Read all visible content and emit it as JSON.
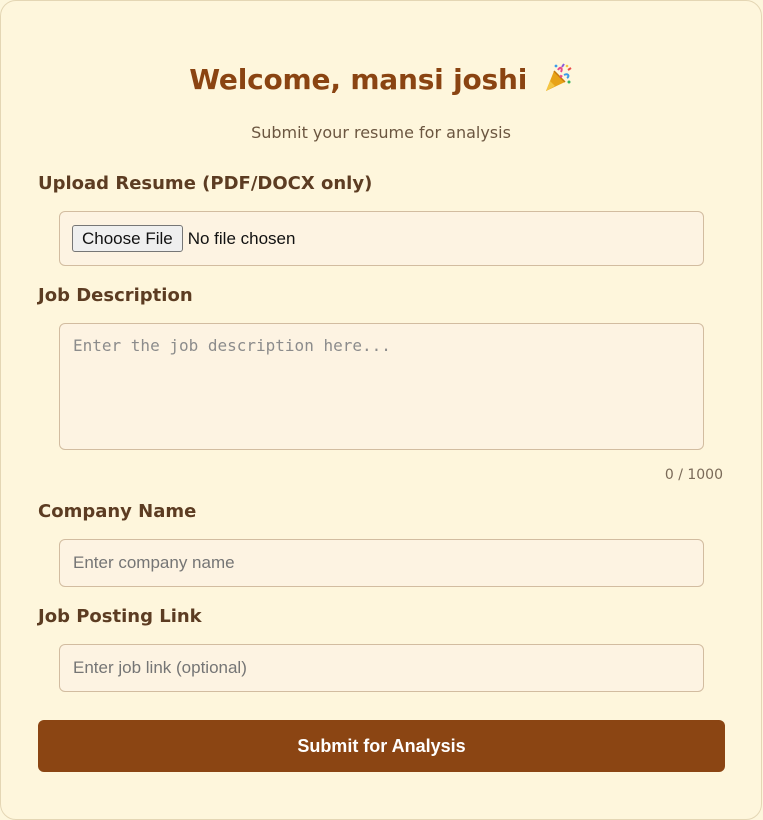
{
  "header": {
    "welcome_prefix": "Welcome, ",
    "user_name": "mansi joshi",
    "emoji_icon": "party-popper-icon",
    "subtitle": "Submit your resume for analysis"
  },
  "form": {
    "resume": {
      "label": "Upload Resume (PDF/DOCX only)",
      "button_label": "Choose File",
      "status": "No file chosen"
    },
    "job_description": {
      "label": "Job Description",
      "placeholder": "Enter the job description here...",
      "value": "",
      "counter": "0 / 1000"
    },
    "company_name": {
      "label": "Company Name",
      "placeholder": "Enter company name",
      "value": ""
    },
    "job_link": {
      "label": "Job Posting Link",
      "placeholder": "Enter job link (optional)",
      "value": ""
    },
    "submit_label": "Submit for Analysis"
  },
  "colors": {
    "background": "#fef6dc",
    "title": "#8a4412",
    "submit": "#8b4513"
  }
}
